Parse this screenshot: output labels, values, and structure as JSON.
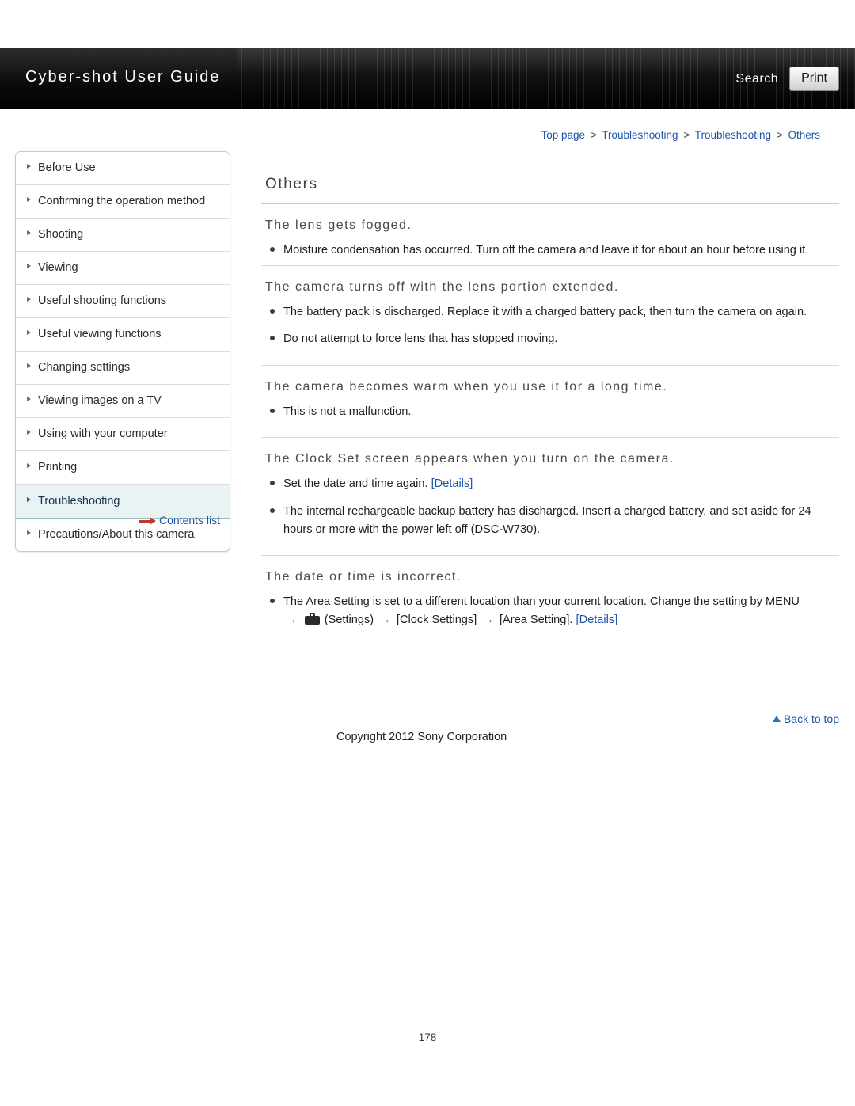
{
  "header": {
    "title": "Cyber-shot User Guide",
    "search_label": "Search",
    "print_label": "Print"
  },
  "breadcrumb": {
    "items": [
      "Top page",
      "Troubleshooting",
      "Troubleshooting",
      "Others"
    ],
    "separator": ">"
  },
  "sidebar": {
    "items": [
      {
        "label": "Before Use"
      },
      {
        "label": "Confirming the operation method"
      },
      {
        "label": "Shooting"
      },
      {
        "label": "Viewing"
      },
      {
        "label": "Useful shooting functions"
      },
      {
        "label": "Useful viewing functions"
      },
      {
        "label": "Changing settings"
      },
      {
        "label": "Viewing images on a TV"
      },
      {
        "label": "Using with your computer"
      },
      {
        "label": "Printing"
      },
      {
        "label": "Troubleshooting"
      },
      {
        "label": "Precautions/About this camera"
      }
    ],
    "active_index": 10,
    "contents_list_label": "Contents list"
  },
  "main": {
    "page_title": "Others",
    "sections": [
      {
        "heading": "The lens gets fogged.",
        "bullets": [
          "Moisture condensation has occurred. Turn off the camera and leave it for about an hour before using it."
        ]
      },
      {
        "heading": "The camera turns off with the lens portion extended.",
        "bullets": [
          "The battery pack is discharged. Replace it with a charged battery pack, then turn the camera on again.",
          "Do not attempt to force lens that has stopped moving."
        ]
      },
      {
        "heading": "The camera becomes warm when you use it for a long time.",
        "bullets": [
          "This is not a malfunction."
        ]
      },
      {
        "heading": "The Clock Set screen appears when you turn on the camera.",
        "bullets": [
          "Set the date and time again. [Details]",
          "The internal rechargeable backup battery has discharged. Insert a charged battery, and set aside for 24 hours or more with the power left off (DSC-W730)."
        ]
      },
      {
        "heading": "The date or time is incorrect.",
        "bullets": [
          "The Area Setting is set to a different location than your current location. Change the setting by MENU"
        ]
      }
    ],
    "clock_set_details_link": "[Details]",
    "clock_set_bullet_prefix": "Set the date and time again. ",
    "area_setting_path": {
      "arrow": "→",
      "settings_label": "(Settings)",
      "clock_settings_label": "[Clock Settings]",
      "area_setting_label": "[Area Setting].",
      "details_link": "[Details]"
    }
  },
  "footer": {
    "back_to_top": "Back to top",
    "copyright": "Copyright 2012 Sony Corporation",
    "page_number": "178"
  }
}
